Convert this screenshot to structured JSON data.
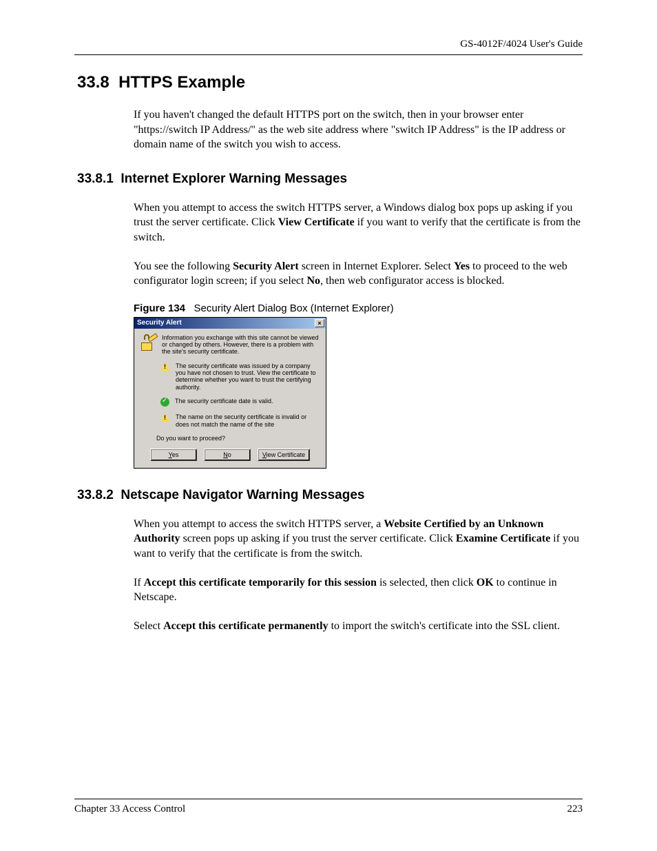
{
  "header": {
    "guide_title": "GS-4012F/4024 User's Guide"
  },
  "section": {
    "number": "33.8",
    "title": "HTTPS Example",
    "intro": "If you haven't changed the default HTTPS port on the switch, then in your browser enter \"https://switch IP Address/\" as the web site address where \"switch IP Address\" is the IP address or domain name of the switch you wish to access."
  },
  "sub1": {
    "number": "33.8.1",
    "title": "Internet Explorer Warning Messages",
    "para1_a": "When you attempt to access the switch HTTPS server, a Windows dialog box pops up asking if you trust the server certificate. Click ",
    "para1_bold": "View Certificate",
    "para1_b": " if you want to verify that the certificate is from the switch.",
    "para2_a": "You see the following ",
    "para2_bold1": "Security Alert",
    "para2_b": " screen in Internet Explorer. Select ",
    "para2_bold2": "Yes",
    "para2_c": " to proceed to the web configurator login screen; if you select ",
    "para2_bold3": "No",
    "para2_d": ", then web configurator access is blocked."
  },
  "figure": {
    "label": "Figure 134",
    "caption": "Security Alert Dialog Box (Internet Explorer)"
  },
  "dialog": {
    "title": "Security Alert",
    "close": "×",
    "intro": "Information you exchange with this site cannot be viewed or changed by others. However, there is a problem with the site's security certificate.",
    "item1": "The security certificate was issued by a company you have not chosen to trust. View the certificate to determine whether you want to trust the certifying authority.",
    "item2": "The security certificate date is valid.",
    "item3": "The name on the security certificate is invalid or does not match the name of the site",
    "proceed": "Do you want to proceed?",
    "btn_yes": "Yes",
    "btn_no": "No",
    "btn_view": "View Certificate"
  },
  "sub2": {
    "number": "33.8.2",
    "title": "Netscape Navigator Warning Messages",
    "para1_a": "When you attempt to access the switch HTTPS server, a ",
    "para1_bold1": "Website Certified by an Unknown Authority",
    "para1_b": " screen pops up asking if you trust the server certificate. Click ",
    "para1_bold2": "Examine Certificate",
    "para1_c": " if you want to verify that the certificate is from the switch.",
    "para2_a": "If ",
    "para2_bold1": "Accept this certificate temporarily for this session",
    "para2_b": " is selected, then click ",
    "para2_bold2": "OK",
    "para2_c": " to continue in Netscape.",
    "para3_a": "Select ",
    "para3_bold1": "Accept this certificate permanently",
    "para3_b": " to import the switch's certificate into the SSL client."
  },
  "footer": {
    "chapter": "Chapter 33 Access Control",
    "page": "223"
  }
}
